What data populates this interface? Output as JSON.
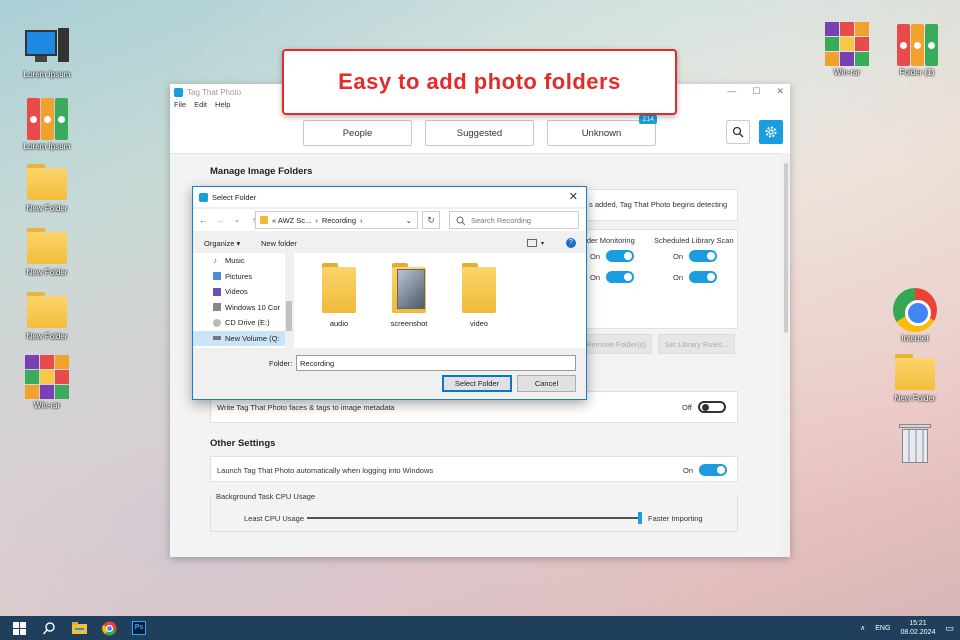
{
  "desktop": {
    "left_icons": [
      {
        "label": "Lorem Ipsum"
      },
      {
        "label": "Lorem Ipsum"
      },
      {
        "label": "New Folder"
      },
      {
        "label": "New Folder"
      },
      {
        "label": "New Folder"
      },
      {
        "label": "Win-rar"
      }
    ],
    "right_icons": [
      {
        "label": "Win-rar"
      },
      {
        "label": "Folder (1)"
      },
      {
        "label": "Internet"
      },
      {
        "label": "New Folder"
      },
      {
        "label": "Recycle Bin"
      }
    ]
  },
  "callout": {
    "text": "Easy to add photo folders",
    "color": "#e52a2a"
  },
  "app": {
    "title": "Tag That Photo",
    "menu": [
      "File",
      "Edit",
      "Help"
    ],
    "tabs": [
      {
        "label": "People"
      },
      {
        "label": "Suggested"
      },
      {
        "label": "Unknown",
        "badge": "214"
      }
    ],
    "accent": "#1a9de0",
    "manage_title": "Manage Image Folders",
    "info_text": "s added, Tag That Photo begins detecting",
    "col_folder_monitoring": "older Monitoring",
    "col_scheduled_scan": "Scheduled Library Scan",
    "rows": [
      {
        "monitor": "On",
        "scan": "On"
      },
      {
        "monitor": "On",
        "scan": "On"
      }
    ],
    "remove_btn": "Remove Folder(s)",
    "rules_btn": "Set Library Rules...",
    "metadata_label": "Write Tag That Photo faces & tags to image metadata",
    "metadata_state": "Off",
    "other_title": "Other Settings",
    "launch_label": "Launch Tag That Photo automatically when logging into Windows",
    "launch_state": "On",
    "cpu_title": "Background Task CPU Usage",
    "cpu_least": "Least CPU Usage",
    "cpu_faster": "Faster Importing",
    "cpu_level": 1.0
  },
  "dialog": {
    "title": "Select Folder",
    "path": [
      "« AWZ Sc...",
      "Recording"
    ],
    "search_placeholder": "Search Recording",
    "organize": "Organize ▾",
    "new_folder": "New folder",
    "sidebar": [
      {
        "label": "Music",
        "icon": "music-icon"
      },
      {
        "label": "Pictures",
        "icon": "pictures-icon"
      },
      {
        "label": "Videos",
        "icon": "videos-icon"
      },
      {
        "label": "Windows 10 Cor",
        "icon": "drive-icon"
      },
      {
        "label": "CD Drive (E:)",
        "icon": "cd-icon"
      },
      {
        "label": "New Volume (Q:",
        "icon": "drive-icon",
        "selected": true
      }
    ],
    "items": [
      {
        "label": "audio"
      },
      {
        "label": "screenshot"
      },
      {
        "label": "video"
      }
    ],
    "folder_label": "Folder:",
    "folder_value": "Recording",
    "select_btn": "Select Folder",
    "cancel_btn": "Cancel"
  },
  "taskbar": {
    "lang": "ENG",
    "time": "15:21",
    "date": "08.02.2024"
  }
}
